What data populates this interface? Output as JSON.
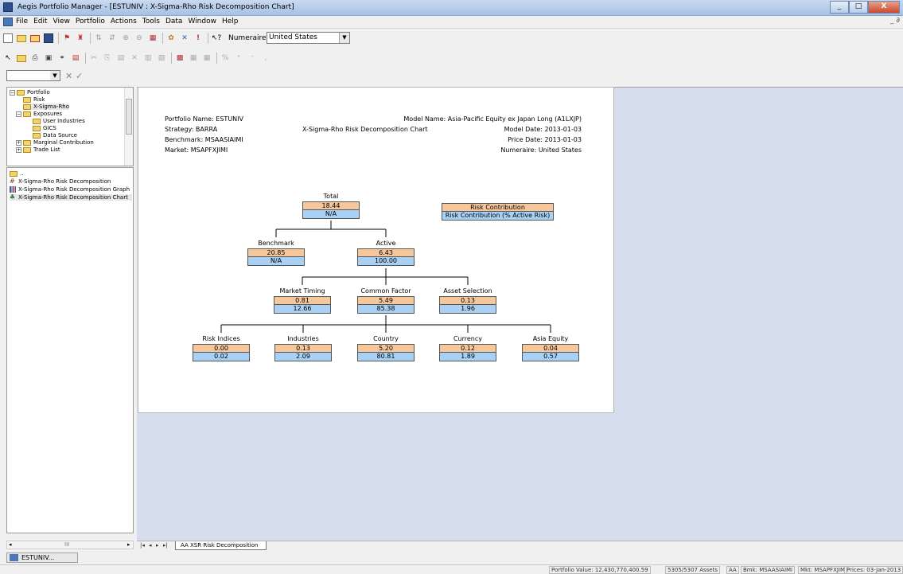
{
  "window": {
    "title": "Aegis Portfolio Manager - [ESTUNIV : X-Sigma-Rho Risk Decomposition Chart]",
    "minimize": "_",
    "maximize": "□",
    "close": "X"
  },
  "menu": {
    "items": [
      "File",
      "Edit",
      "View",
      "Portfolio",
      "Actions",
      "Tools",
      "Data",
      "Window",
      "Help"
    ],
    "mdi_controls": "_ ∂"
  },
  "toolbar": {
    "numeraire_label": "Numeraire:",
    "numeraire_value": "United States"
  },
  "tree": {
    "items": [
      {
        "label": "Portfolio"
      },
      {
        "label": "Risk"
      },
      {
        "label": "X-Sigma-Rho"
      },
      {
        "label": "Exposures"
      },
      {
        "label": "User Industries"
      },
      {
        "label": "GICS"
      },
      {
        "label": "Data Source"
      },
      {
        "label": "Marginal Contribution"
      },
      {
        "label": "Trade List"
      }
    ]
  },
  "list": {
    "items": [
      {
        "label": ".."
      },
      {
        "label": "X-Sigma-Rho Risk Decomposition"
      },
      {
        "label": "X-Sigma-Rho Risk Decomposition Graph"
      },
      {
        "label": "X-Sigma-Rho Risk Decomposition Chart"
      }
    ]
  },
  "scroll": {
    "grip": "III"
  },
  "report": {
    "portfolio_name": "Portfolio Name: ESTUNIV",
    "strategy": "Strategy: BARRA",
    "benchmark": "Benchmark: MSAASIAIMI",
    "market": "Market: MSAPFXJIMI",
    "chart_title": "X-Sigma-Rho Risk Decomposition Chart",
    "model_name": "Model Name: Asia-Pacific Equity ex Japan Long (A1LXJP)",
    "model_date": "Model Date: 2013-01-03",
    "price_date": "Price Date: 2013-01-03",
    "numeraire": "Numeraire: United States"
  },
  "legend": {
    "risk_contribution": "Risk Contribution",
    "risk_contribution_pct": "Risk Contribution (% Active Risk)"
  },
  "tree_nodes": {
    "total": {
      "label": "Total",
      "v1": "18.44",
      "v2": "N/A"
    },
    "benchmark": {
      "label": "Benchmark",
      "v1": "20.85",
      "v2": "N/A"
    },
    "active": {
      "label": "Active",
      "v1": "6.43",
      "v2": "100.00"
    },
    "market_timing": {
      "label": "Market Timing",
      "v1": "0.81",
      "v2": "12.66"
    },
    "common_factor": {
      "label": "Common Factor",
      "v1": "5.49",
      "v2": "85.38"
    },
    "asset_selection": {
      "label": "Asset Selection",
      "v1": "0.13",
      "v2": "1.96"
    },
    "risk_indices": {
      "label": "Risk Indices",
      "v1": "0.00",
      "v2": "0.02"
    },
    "industries": {
      "label": "Industries",
      "v1": "0.13",
      "v2": "2.09"
    },
    "country": {
      "label": "Country",
      "v1": "5.20",
      "v2": "80.81"
    },
    "currency": {
      "label": "Currency",
      "v1": "0.12",
      "v2": "1.89"
    },
    "asia_equity": {
      "label": "Asia Equity",
      "v1": "0.04",
      "v2": "0.57"
    }
  },
  "sheet_tab": "AA XSR Risk Decomposition",
  "taskbar": {
    "window_label": "ESTUNIV..."
  },
  "status": {
    "portfolio_value": "Portfolio Value: 12,430,770,400.59",
    "assets": "5305/5307 Assets",
    "aa": "AA",
    "bmk": "Bmk: MSAASIAIMI",
    "mkt": "Mkt: MSAPFXJIM",
    "prices": "Prices: 03-Jan-2013"
  },
  "colors": {
    "risk_contribution": "#f7c79c",
    "risk_contribution_pct": "#a9d0f5",
    "mdi_background": "#d6ddec"
  }
}
